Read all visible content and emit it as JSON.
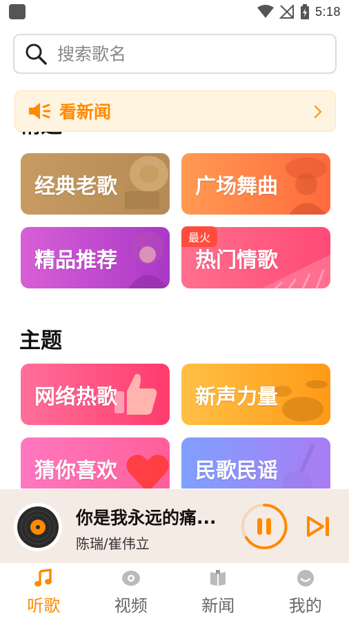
{
  "status_bar": {
    "time": "5:18"
  },
  "search": {
    "placeholder": "搜索歌名"
  },
  "news_banner": {
    "label": "看新闻"
  },
  "sections": {
    "featured_title": "精选",
    "themes_title": "主题"
  },
  "featured_tiles": [
    {
      "label": "经典老歌"
    },
    {
      "label": "广场舞曲"
    },
    {
      "label": "精品推荐"
    },
    {
      "label": "热门情歌",
      "badge": "最火"
    }
  ],
  "theme_tiles": [
    {
      "label": "网络热歌"
    },
    {
      "label": "新声力量"
    },
    {
      "label": "猜你喜欢"
    },
    {
      "label": "民歌民谣"
    }
  ],
  "player": {
    "song_title": "你是我永远的痛...",
    "artist": "陈瑞/崔伟立"
  },
  "bottom_nav": [
    {
      "label": "听歌",
      "active": true
    },
    {
      "label": "视频",
      "active": false
    },
    {
      "label": "新闻",
      "active": false
    },
    {
      "label": "我的",
      "active": false
    }
  ],
  "colors": {
    "accent": "#ff8a00",
    "inactive": "#666666"
  }
}
